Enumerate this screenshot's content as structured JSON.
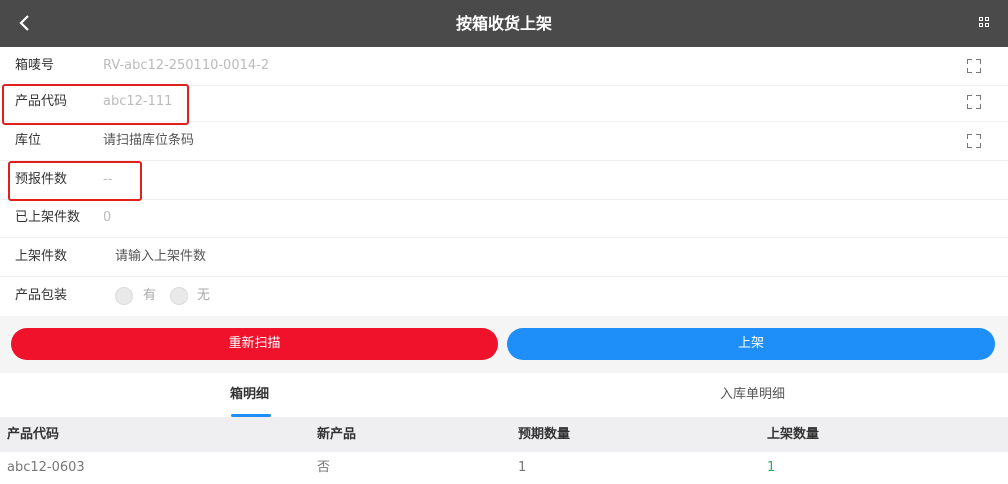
{
  "header": {
    "title": "按箱收货上架",
    "back_icon": "‹"
  },
  "form": {
    "box_no": {
      "label": "箱唛号",
      "value": "RV-abc12-250110-0014-2"
    },
    "product_code": {
      "label": "产品代码",
      "value": "abc12-111"
    },
    "location": {
      "label": "库位",
      "placeholder": "请扫描库位条码"
    },
    "forecast_qty": {
      "label": "预报件数",
      "value": "--"
    },
    "shelved_qty": {
      "label": "已上架件数",
      "value": "0"
    },
    "shelve_qty": {
      "label": "上架件数",
      "placeholder": "请输入上架件数"
    },
    "packaging": {
      "label": "产品包装",
      "options": [
        "有",
        "无"
      ]
    }
  },
  "buttons": {
    "rescan": "重新扫描",
    "shelve": "上架"
  },
  "tabs": {
    "box_detail": "箱明细",
    "inbound_detail": "入库单明细"
  },
  "table": {
    "headers": [
      "产品代码",
      "新产品",
      "预期数量",
      "上架数量"
    ],
    "rows": [
      {
        "product_code": "abc12-0603",
        "new_product": "否",
        "expected": "1",
        "shelved": "1"
      }
    ]
  },
  "colors": {
    "header_bg": "#4a4a4a",
    "rescan": "#f0112b",
    "shelve": "#1e8ff8",
    "highlight": "#e0201d",
    "shelved_value": "#2fae5b"
  }
}
